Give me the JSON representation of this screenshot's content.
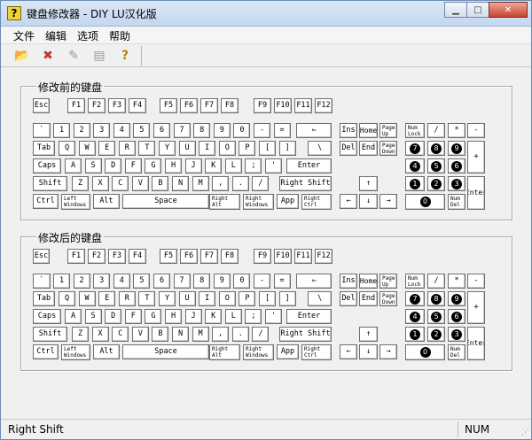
{
  "window": {
    "title": "键盘修改器 - DIY   LU汉化版",
    "icon": "help-question-icon",
    "minimize": "minimize-icon",
    "maximize": "maximize-icon",
    "close": "close-icon"
  },
  "menu": [
    "文件",
    "编辑",
    "选项",
    "帮助"
  ],
  "toolbar": [
    "open-icon",
    "delete-icon",
    "edit-icon",
    "document-icon",
    "help-icon"
  ],
  "panels": [
    {
      "title": "修改前的键盘"
    },
    {
      "title": "修改后的键盘"
    }
  ],
  "keys": {
    "esc": "Esc",
    "f": [
      "F1",
      "F2",
      "F3",
      "F4",
      "F5",
      "F6",
      "F7",
      "F8",
      "F9",
      "F10",
      "F11",
      "F12"
    ],
    "row1": [
      "`",
      "1",
      "2",
      "3",
      "4",
      "5",
      "6",
      "7",
      "8",
      "9",
      "0",
      "-",
      "=",
      "⇐"
    ],
    "row2": [
      "Tab",
      "Q",
      "W",
      "E",
      "R",
      "T",
      "Y",
      "U",
      "I",
      "O",
      "P",
      "[",
      "]",
      "\\"
    ],
    "row3": [
      "Caps",
      "A",
      "S",
      "D",
      "F",
      "G",
      "H",
      "J",
      "K",
      "L",
      ";",
      "'",
      "Enter"
    ],
    "row4": [
      "Shift",
      "Z",
      "X",
      "C",
      "V",
      "B",
      "N",
      "M",
      ",",
      ".",
      "/",
      "Right Shift"
    ],
    "row5": [
      "Ctrl",
      "Left Windows",
      "Alt",
      "Space",
      "Right Alt",
      "Right Windows",
      "App",
      "Right Ctrl"
    ],
    "nav": [
      "Ins",
      "Home",
      "Page Up",
      "Del",
      "End",
      "Page Down"
    ],
    "arrows": [
      "↑",
      "←",
      "↓",
      "→"
    ],
    "numpad": [
      "Num Lock",
      "/",
      "*",
      "-",
      "7",
      "8",
      "9",
      "+",
      "4",
      "5",
      "6",
      "1",
      "2",
      "3",
      "Enter",
      "0",
      "Num Del"
    ]
  },
  "status": {
    "left": "Right Shift",
    "right": "NUM"
  }
}
